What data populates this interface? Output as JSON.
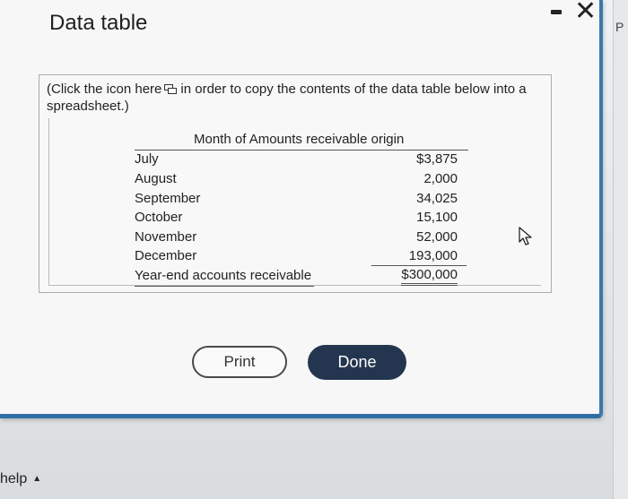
{
  "dialog": {
    "title": "Data table",
    "instruction_before_icon": "(Click the icon here",
    "instruction_after_icon": "in order to copy the contents of the data table below into a spreadsheet.)"
  },
  "table": {
    "header": "Month of Amounts receivable origin",
    "rows": [
      {
        "label": "July",
        "amount": "$3,875"
      },
      {
        "label": "August",
        "amount": "2,000"
      },
      {
        "label": "September",
        "amount": "34,025"
      },
      {
        "label": "October",
        "amount": "15,100"
      },
      {
        "label": "November",
        "amount": "52,000"
      },
      {
        "label": "December",
        "amount": "193,000"
      }
    ],
    "total": {
      "label": "Year-end accounts receivable",
      "amount": "$300,000"
    }
  },
  "buttons": {
    "print": "Print",
    "done": "Done"
  },
  "footer": {
    "help": "help",
    "help_caret": "▲"
  },
  "edge_peek": "P",
  "colors": {
    "done_button": "#24364f",
    "dialog_border": "#2f6fa3"
  }
}
